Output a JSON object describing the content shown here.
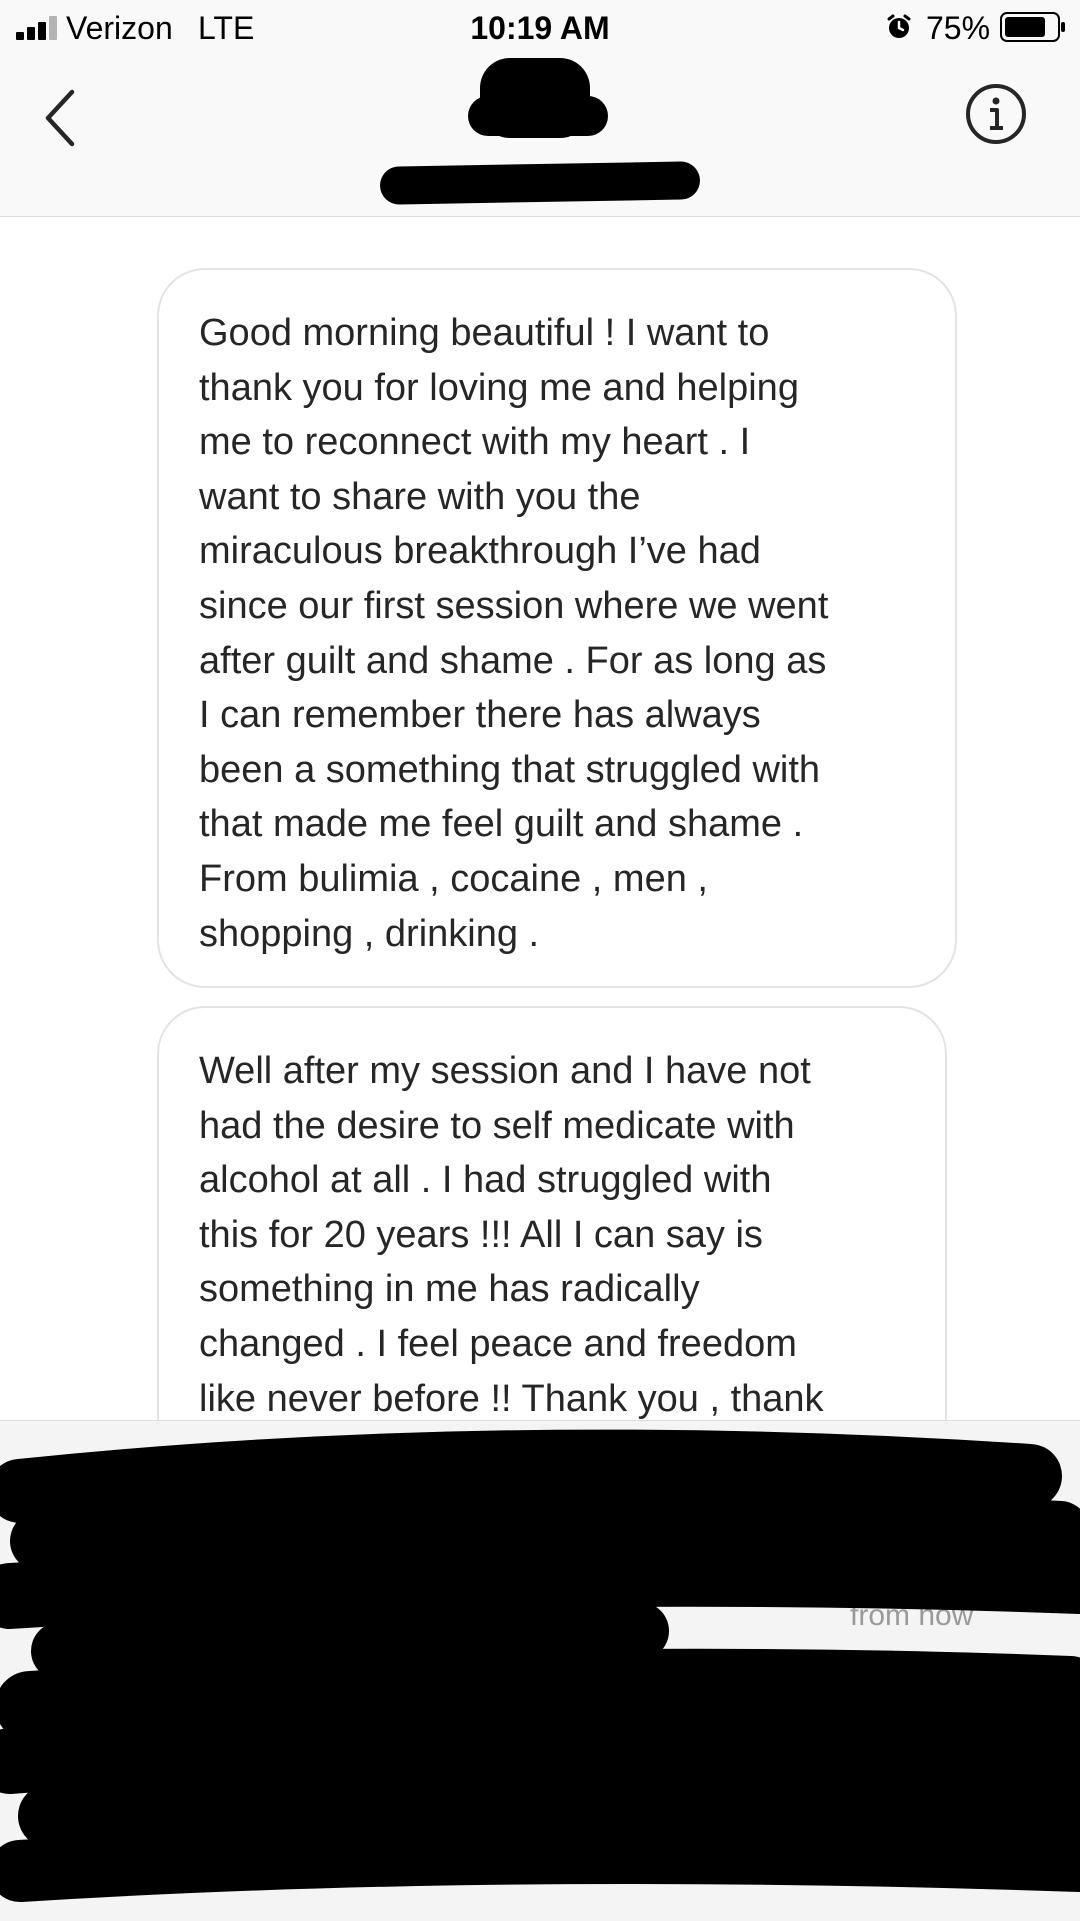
{
  "status_bar": {
    "carrier": "Verizon",
    "network": "LTE",
    "time": "10:19 AM",
    "battery_percent": "75%",
    "icons": [
      "signal-icon",
      "alarm-icon",
      "battery-icon"
    ]
  },
  "header": {
    "back_icon": "chevron-left-icon",
    "info_icon": "info-icon"
  },
  "messages": [
    {
      "text": "Good morning beautiful ! I want to\nthank you for loving me and helping\nme to reconnect with my heart . I\nwant to share with you the\nmiraculous breakthrough I’ve had\nsince our first session where we went\nafter guilt and shame . For as long as\nI can remember there has always\nbeen a something that struggled with\nthat made me feel guilt and shame .\nFrom bulimia , cocaine , men ,\nshopping , drinking ."
    },
    {
      "text": "Well after my session  and I have not\nhad the desire to self medicate with\nalcohol at all . I had struggled with\nthis for 20 years !!! All I can say is\nsomething in me has radically\nchanged . I feel peace and freedom\nlike never before !! Thank you , thank"
    }
  ],
  "footer": {
    "visible_fragment": "from now"
  },
  "colors": {
    "bar_background": "#f9f9f9",
    "bubble_border": "#e3e3e3",
    "text": "#262626",
    "redaction": "#000000"
  }
}
